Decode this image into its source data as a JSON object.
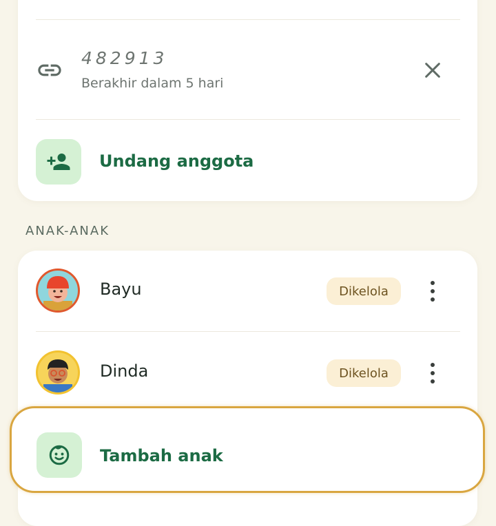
{
  "invite": {
    "code": "482913",
    "expiry": "Berakhir dalam 5 hari",
    "invite_member_label": "Undang anggota"
  },
  "children_section": {
    "title": "ANAK-ANAK",
    "children": [
      {
        "name": "Bayu",
        "badge": "Dikelola"
      },
      {
        "name": "Dinda",
        "badge": "Dikelola"
      }
    ],
    "add_child_label": "Tambah anak"
  },
  "icons": {
    "link": "link-icon",
    "close": "close-icon",
    "add_member": "person-add-icon",
    "more": "more-vert-icon",
    "add_child": "child-face-icon"
  },
  "colors": {
    "background": "#f8f5ea",
    "card": "#ffffff",
    "accent_green": "#1c6b44",
    "tile_green": "#d5f1d4",
    "badge_bg": "#fbefd5",
    "highlight_border": "#d9a640"
  }
}
